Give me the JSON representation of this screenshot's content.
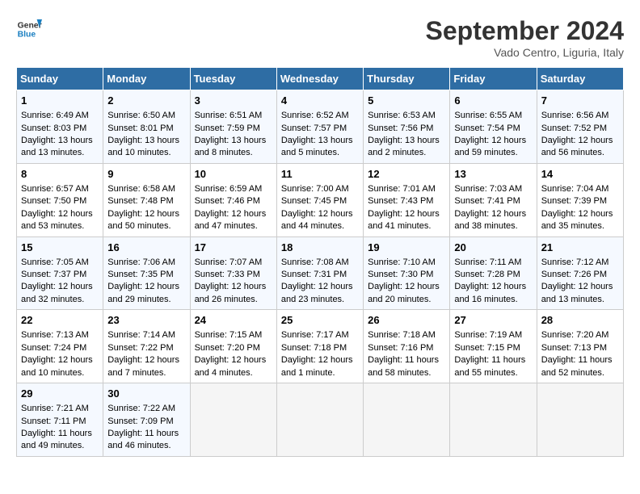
{
  "logo": {
    "line1": "General",
    "line2": "Blue"
  },
  "title": "September 2024",
  "subtitle": "Vado Centro, Liguria, Italy",
  "days_header": [
    "Sunday",
    "Monday",
    "Tuesday",
    "Wednesday",
    "Thursday",
    "Friday",
    "Saturday"
  ],
  "weeks": [
    [
      {
        "day": "1",
        "lines": [
          "Sunrise: 6:49 AM",
          "Sunset: 8:03 PM",
          "Daylight: 13 hours",
          "and 13 minutes."
        ]
      },
      {
        "day": "2",
        "lines": [
          "Sunrise: 6:50 AM",
          "Sunset: 8:01 PM",
          "Daylight: 13 hours",
          "and 10 minutes."
        ]
      },
      {
        "day": "3",
        "lines": [
          "Sunrise: 6:51 AM",
          "Sunset: 7:59 PM",
          "Daylight: 13 hours",
          "and 8 minutes."
        ]
      },
      {
        "day": "4",
        "lines": [
          "Sunrise: 6:52 AM",
          "Sunset: 7:57 PM",
          "Daylight: 13 hours",
          "and 5 minutes."
        ]
      },
      {
        "day": "5",
        "lines": [
          "Sunrise: 6:53 AM",
          "Sunset: 7:56 PM",
          "Daylight: 13 hours",
          "and 2 minutes."
        ]
      },
      {
        "day": "6",
        "lines": [
          "Sunrise: 6:55 AM",
          "Sunset: 7:54 PM",
          "Daylight: 12 hours",
          "and 59 minutes."
        ]
      },
      {
        "day": "7",
        "lines": [
          "Sunrise: 6:56 AM",
          "Sunset: 7:52 PM",
          "Daylight: 12 hours",
          "and 56 minutes."
        ]
      }
    ],
    [
      {
        "day": "8",
        "lines": [
          "Sunrise: 6:57 AM",
          "Sunset: 7:50 PM",
          "Daylight: 12 hours",
          "and 53 minutes."
        ]
      },
      {
        "day": "9",
        "lines": [
          "Sunrise: 6:58 AM",
          "Sunset: 7:48 PM",
          "Daylight: 12 hours",
          "and 50 minutes."
        ]
      },
      {
        "day": "10",
        "lines": [
          "Sunrise: 6:59 AM",
          "Sunset: 7:46 PM",
          "Daylight: 12 hours",
          "and 47 minutes."
        ]
      },
      {
        "day": "11",
        "lines": [
          "Sunrise: 7:00 AM",
          "Sunset: 7:45 PM",
          "Daylight: 12 hours",
          "and 44 minutes."
        ]
      },
      {
        "day": "12",
        "lines": [
          "Sunrise: 7:01 AM",
          "Sunset: 7:43 PM",
          "Daylight: 12 hours",
          "and 41 minutes."
        ]
      },
      {
        "day": "13",
        "lines": [
          "Sunrise: 7:03 AM",
          "Sunset: 7:41 PM",
          "Daylight: 12 hours",
          "and 38 minutes."
        ]
      },
      {
        "day": "14",
        "lines": [
          "Sunrise: 7:04 AM",
          "Sunset: 7:39 PM",
          "Daylight: 12 hours",
          "and 35 minutes."
        ]
      }
    ],
    [
      {
        "day": "15",
        "lines": [
          "Sunrise: 7:05 AM",
          "Sunset: 7:37 PM",
          "Daylight: 12 hours",
          "and 32 minutes."
        ]
      },
      {
        "day": "16",
        "lines": [
          "Sunrise: 7:06 AM",
          "Sunset: 7:35 PM",
          "Daylight: 12 hours",
          "and 29 minutes."
        ]
      },
      {
        "day": "17",
        "lines": [
          "Sunrise: 7:07 AM",
          "Sunset: 7:33 PM",
          "Daylight: 12 hours",
          "and 26 minutes."
        ]
      },
      {
        "day": "18",
        "lines": [
          "Sunrise: 7:08 AM",
          "Sunset: 7:31 PM",
          "Daylight: 12 hours",
          "and 23 minutes."
        ]
      },
      {
        "day": "19",
        "lines": [
          "Sunrise: 7:10 AM",
          "Sunset: 7:30 PM",
          "Daylight: 12 hours",
          "and 20 minutes."
        ]
      },
      {
        "day": "20",
        "lines": [
          "Sunrise: 7:11 AM",
          "Sunset: 7:28 PM",
          "Daylight: 12 hours",
          "and 16 minutes."
        ]
      },
      {
        "day": "21",
        "lines": [
          "Sunrise: 7:12 AM",
          "Sunset: 7:26 PM",
          "Daylight: 12 hours",
          "and 13 minutes."
        ]
      }
    ],
    [
      {
        "day": "22",
        "lines": [
          "Sunrise: 7:13 AM",
          "Sunset: 7:24 PM",
          "Daylight: 12 hours",
          "and 10 minutes."
        ]
      },
      {
        "day": "23",
        "lines": [
          "Sunrise: 7:14 AM",
          "Sunset: 7:22 PM",
          "Daylight: 12 hours",
          "and 7 minutes."
        ]
      },
      {
        "day": "24",
        "lines": [
          "Sunrise: 7:15 AM",
          "Sunset: 7:20 PM",
          "Daylight: 12 hours",
          "and 4 minutes."
        ]
      },
      {
        "day": "25",
        "lines": [
          "Sunrise: 7:17 AM",
          "Sunset: 7:18 PM",
          "Daylight: 12 hours",
          "and 1 minute."
        ]
      },
      {
        "day": "26",
        "lines": [
          "Sunrise: 7:18 AM",
          "Sunset: 7:16 PM",
          "Daylight: 11 hours",
          "and 58 minutes."
        ]
      },
      {
        "day": "27",
        "lines": [
          "Sunrise: 7:19 AM",
          "Sunset: 7:15 PM",
          "Daylight: 11 hours",
          "and 55 minutes."
        ]
      },
      {
        "day": "28",
        "lines": [
          "Sunrise: 7:20 AM",
          "Sunset: 7:13 PM",
          "Daylight: 11 hours",
          "and 52 minutes."
        ]
      }
    ],
    [
      {
        "day": "29",
        "lines": [
          "Sunrise: 7:21 AM",
          "Sunset: 7:11 PM",
          "Daylight: 11 hours",
          "and 49 minutes."
        ]
      },
      {
        "day": "30",
        "lines": [
          "Sunrise: 7:22 AM",
          "Sunset: 7:09 PM",
          "Daylight: 11 hours",
          "and 46 minutes."
        ]
      },
      {
        "day": "",
        "lines": []
      },
      {
        "day": "",
        "lines": []
      },
      {
        "day": "",
        "lines": []
      },
      {
        "day": "",
        "lines": []
      },
      {
        "day": "",
        "lines": []
      }
    ]
  ]
}
